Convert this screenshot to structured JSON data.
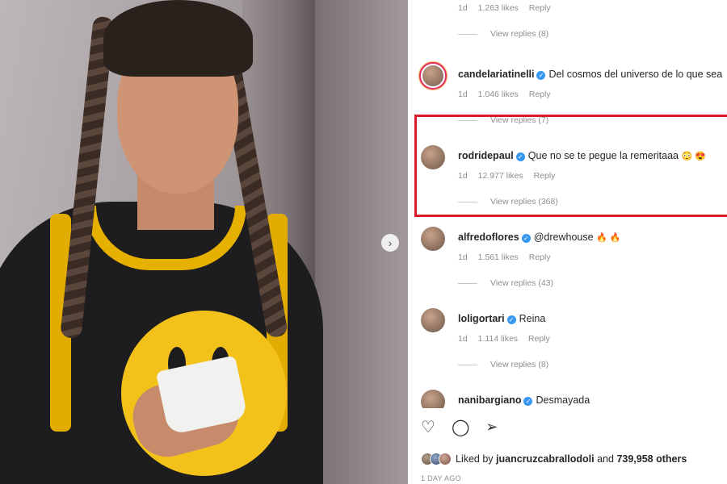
{
  "photo": {
    "next_icon": "chevron-right-icon"
  },
  "comments": [
    {
      "username": "",
      "text": "",
      "time": "1d",
      "likes": "1.263 likes",
      "reply": "Reply",
      "view_replies": "View replies (8)"
    },
    {
      "username": "candelariatinelli",
      "text": "Del cosmos del universo de lo que sea",
      "time": "1d",
      "likes": "1.046 likes",
      "reply": "Reply",
      "view_replies": "View replies (7)"
    },
    {
      "username": "rodridepaul",
      "text": "Que no se te pegue la remeritaaa",
      "emoji": "😳 😍",
      "time": "1d",
      "likes": "12.977 likes",
      "reply": "Reply",
      "view_replies": "View replies (368)"
    },
    {
      "username": "alfredoflores",
      "text": "@drewhouse",
      "emoji": "🔥 🔥",
      "time": "1d",
      "likes": "1.561 likes",
      "reply": "Reply",
      "view_replies": "View replies (43)"
    },
    {
      "username": "loligortari",
      "text": "Reina",
      "time": "1d",
      "likes": "1.114 likes",
      "reply": "Reply",
      "view_replies": "View replies (8)"
    },
    {
      "username": "nanibargiano",
      "text": "Desmayada"
    }
  ],
  "actions": {
    "like_icon": "heart-icon",
    "comment_icon": "comment-icon",
    "share_icon": "share-icon"
  },
  "liked_by": {
    "prefix": "Liked by",
    "user": "juancruzcabrallodoli",
    "and": "and",
    "others": "739,958 others"
  },
  "time_ago": "1 DAY AGO",
  "colors": {
    "highlight": "#d9192a",
    "verified": "#3897f0",
    "muted": "#8e8e8e"
  }
}
